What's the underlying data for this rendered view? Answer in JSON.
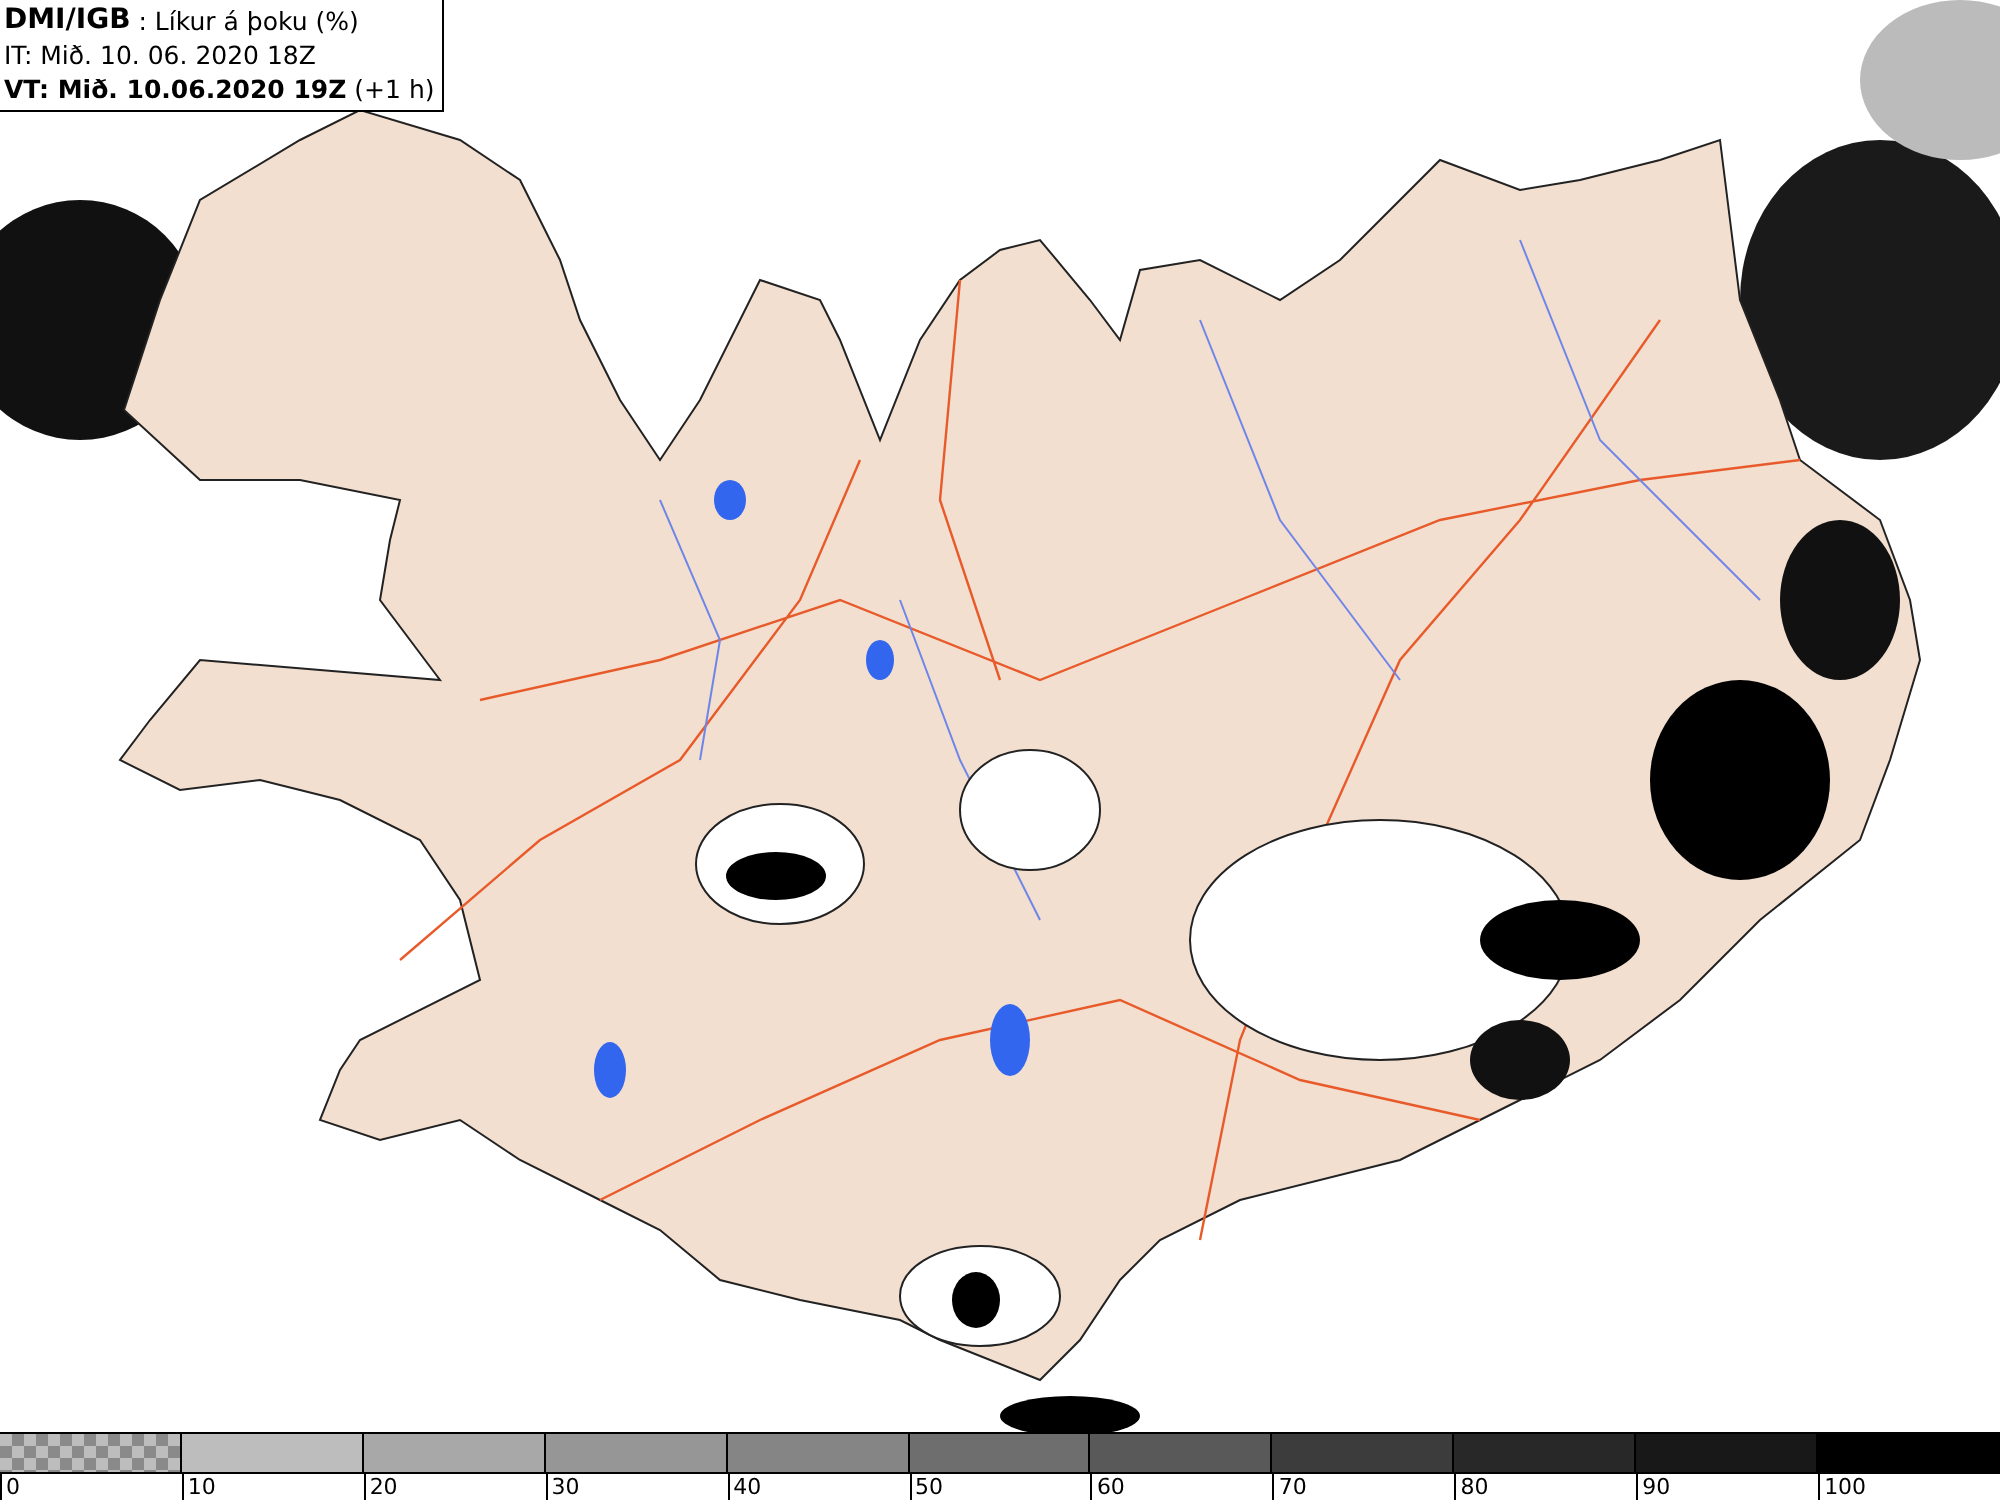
{
  "header": {
    "source": "DMI/IGB",
    "product": ": Líkur á þoku (%)",
    "issued": "IT: Mið. 10. 06. 2020 18Z",
    "valid_time": "VT: Mið. 10.06.2020 19Z",
    "lead": "(+1 h)"
  },
  "legend": {
    "segments": [
      {
        "kind": "checker",
        "color": "#8a8a8a",
        "tick": "0"
      },
      {
        "kind": "solid",
        "color": "#bdbdbd",
        "tick": "10"
      },
      {
        "kind": "solid",
        "color": "#a8a8a8",
        "tick": "20"
      },
      {
        "kind": "solid",
        "color": "#969696",
        "tick": "30"
      },
      {
        "kind": "solid",
        "color": "#858585",
        "tick": "40"
      },
      {
        "kind": "solid",
        "color": "#6e6e6e",
        "tick": "50"
      },
      {
        "kind": "solid",
        "color": "#595959",
        "tick": "60"
      },
      {
        "kind": "solid",
        "color": "#3c3c3c",
        "tick": "70"
      },
      {
        "kind": "solid",
        "color": "#282828",
        "tick": "80"
      },
      {
        "kind": "solid",
        "color": "#181818",
        "tick": "90"
      },
      {
        "kind": "solid",
        "color": "#000000",
        "tick": "100"
      }
    ]
  }
}
